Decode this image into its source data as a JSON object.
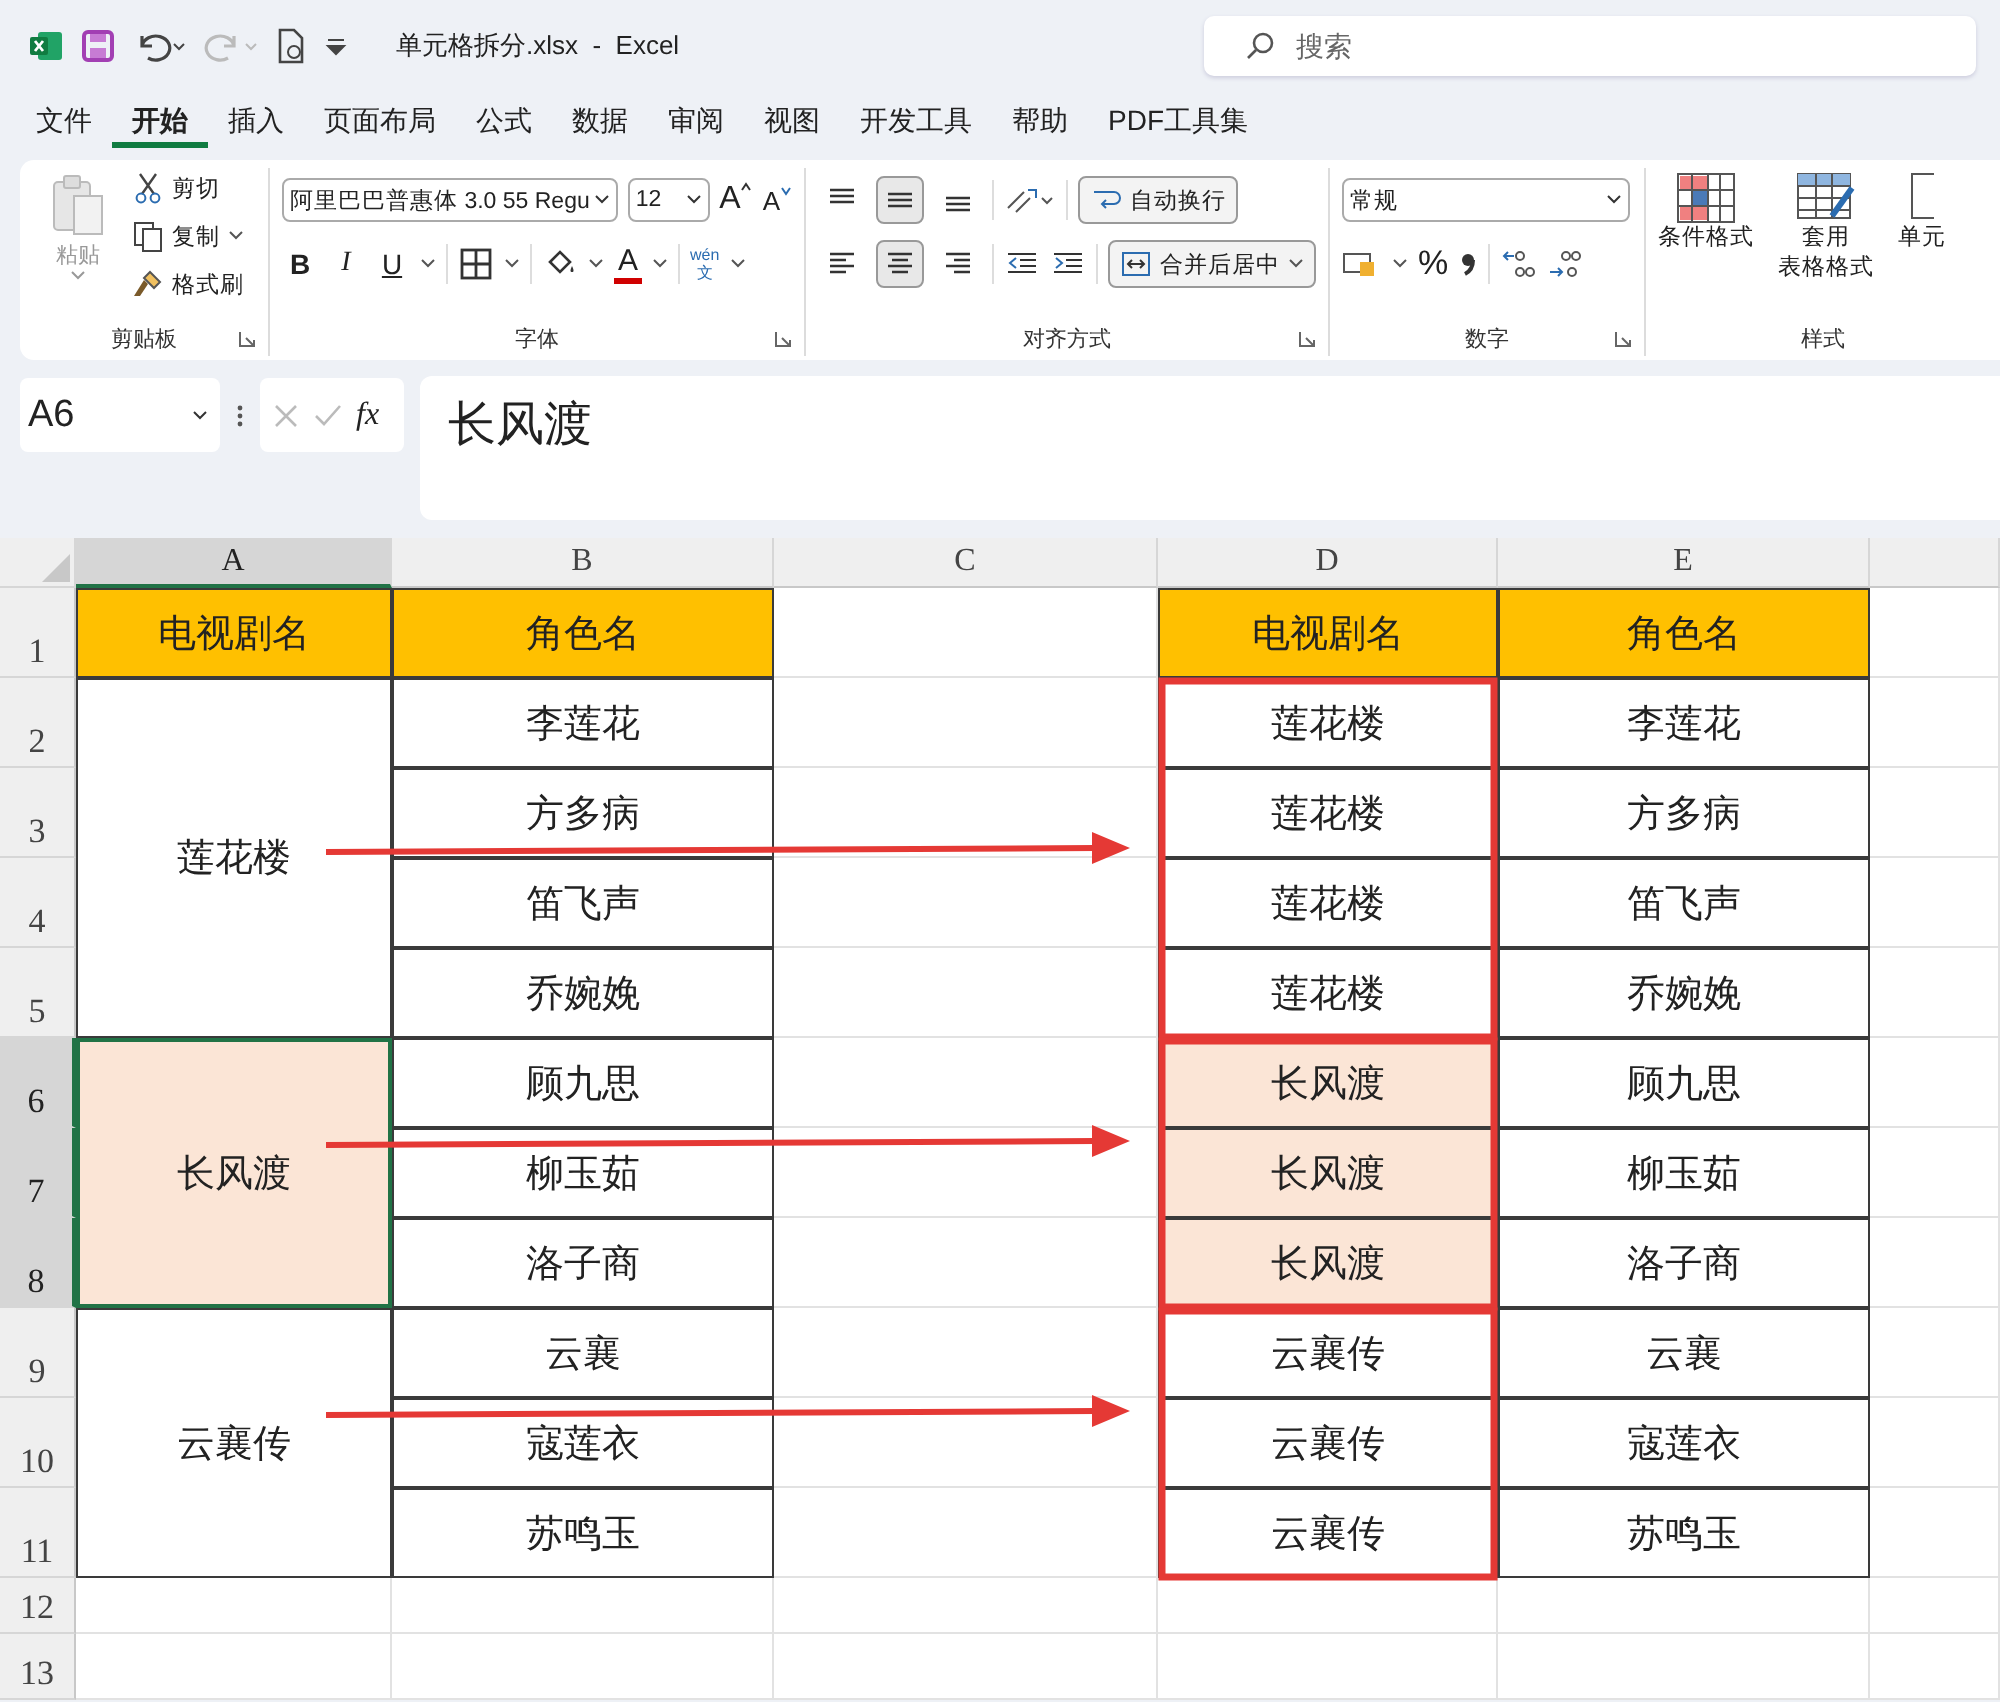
{
  "title_bar": {
    "file_title": "单元格拆分.xlsx  -  Excel",
    "search": {
      "placeholder": "搜索"
    }
  },
  "tabs": [
    {
      "label": "文件",
      "selected": false
    },
    {
      "label": "开始",
      "selected": true
    },
    {
      "label": "插入",
      "selected": false
    },
    {
      "label": "页面布局",
      "selected": false
    },
    {
      "label": "公式",
      "selected": false
    },
    {
      "label": "数据",
      "selected": false
    },
    {
      "label": "审阅",
      "selected": false
    },
    {
      "label": "视图",
      "selected": false
    },
    {
      "label": "开发工具",
      "selected": false
    },
    {
      "label": "帮助",
      "selected": false
    },
    {
      "label": "PDF工具集",
      "selected": false
    }
  ],
  "ribbon": {
    "clipboard": {
      "paste": {
        "label": "粘贴",
        "disabled": true
      },
      "items": [
        {
          "kind": "cut",
          "label": "剪切"
        },
        {
          "kind": "copy",
          "label": "复制"
        },
        {
          "kind": "painter",
          "label": "格式刷"
        }
      ],
      "label": "剪贴板"
    },
    "font": {
      "font_name": "阿里巴巴普惠体 3.0 55 Regu",
      "size": "12",
      "size_buttons": [
        {
          "kind": "grow",
          "label": "A"
        },
        {
          "kind": "shrink",
          "label": "A"
        }
      ],
      "styles": [
        {
          "kind": "bold",
          "label": "B"
        },
        {
          "kind": "italic",
          "label": "I"
        },
        {
          "kind": "underline",
          "label": "U"
        }
      ],
      "font_color": "A",
      "phonetic": {
        "top": "wén",
        "bottom": "文"
      },
      "label": "字体"
    },
    "alignment": {
      "vertical": [
        {
          "kind": "top",
          "selected": false
        },
        {
          "kind": "middle",
          "selected": true
        },
        {
          "kind": "bottom",
          "selected": false
        }
      ],
      "horizontal": [
        {
          "kind": "left",
          "selected": false
        },
        {
          "kind": "center",
          "selected": true
        },
        {
          "kind": "right",
          "selected": false
        }
      ],
      "wrap_text": "自动换行",
      "merge": "合并后居中",
      "label": "对齐方式"
    },
    "number": {
      "format": "常规",
      "percent": "%",
      "label": "数字"
    },
    "styles": {
      "items": [
        {
          "kind": "conditional",
          "lines": [
            "条件格式"
          ]
        },
        {
          "kind": "table",
          "lines": [
            "套用",
            "表格格式"
          ]
        },
        {
          "kind": "cell",
          "lines": [
            "单元"
          ]
        }
      ],
      "label": "样式"
    }
  },
  "formula_bar": {
    "name_box": "A6",
    "fx": "fx",
    "content": "长风渡"
  },
  "sheet": {
    "columns": [
      {
        "label": "A",
        "selected": true
      },
      {
        "label": "B",
        "selected": false
      },
      {
        "label": "C",
        "selected": false
      },
      {
        "label": "D",
        "selected": false
      },
      {
        "label": "E",
        "selected": false
      }
    ],
    "rows": [
      {
        "label": "1",
        "selected": false
      },
      {
        "label": "2",
        "selected": false
      },
      {
        "label": "3",
        "selected": false
      },
      {
        "label": "4",
        "selected": false
      },
      {
        "label": "5",
        "selected": false
      },
      {
        "label": "6",
        "selected": true
      },
      {
        "label": "7",
        "selected": true
      },
      {
        "label": "8",
        "selected": true
      },
      {
        "label": "9",
        "selected": false
      },
      {
        "label": "10",
        "selected": false
      },
      {
        "label": "11",
        "selected": false
      },
      {
        "label": "12",
        "selected": false
      },
      {
        "label": "13",
        "selected": false
      }
    ],
    "left_table": {
      "headers": [
        "电视剧名",
        "角色名"
      ],
      "groups": [
        {
          "drama": "莲花楼",
          "selected": false,
          "roles": [
            "李莲花",
            "方多病",
            "笛飞声",
            "乔婉娩"
          ]
        },
        {
          "drama": "长风渡",
          "selected": true,
          "roles": [
            "顾九思",
            "柳玉茹",
            "洛子商"
          ]
        },
        {
          "drama": "云襄传",
          "selected": false,
          "roles": [
            "云襄",
            "寇莲衣",
            "苏鸣玉"
          ]
        }
      ]
    },
    "right_table": {
      "headers": [
        "电视剧名",
        "角色名"
      ],
      "groups": [
        {
          "highlighted": false,
          "rows": [
            {
              "drama": "莲花楼",
              "role": "李莲花"
            },
            {
              "drama": "莲花楼",
              "role": "方多病"
            },
            {
              "drama": "莲花楼",
              "role": "笛飞声"
            },
            {
              "drama": "莲花楼",
              "role": "乔婉娩"
            }
          ]
        },
        {
          "highlighted": true,
          "rows": [
            {
              "drama": "长风渡",
              "role": "顾九思"
            },
            {
              "drama": "长风渡",
              "role": "柳玉茹"
            },
            {
              "drama": "长风渡",
              "role": "洛子商"
            }
          ]
        },
        {
          "highlighted": false,
          "rows": [
            {
              "drama": "云襄传",
              "role": "云襄"
            },
            {
              "drama": "云襄传",
              "role": "寇莲衣"
            },
            {
              "drama": "云襄传",
              "role": "苏鸣玉"
            }
          ]
        }
      ]
    }
  }
}
